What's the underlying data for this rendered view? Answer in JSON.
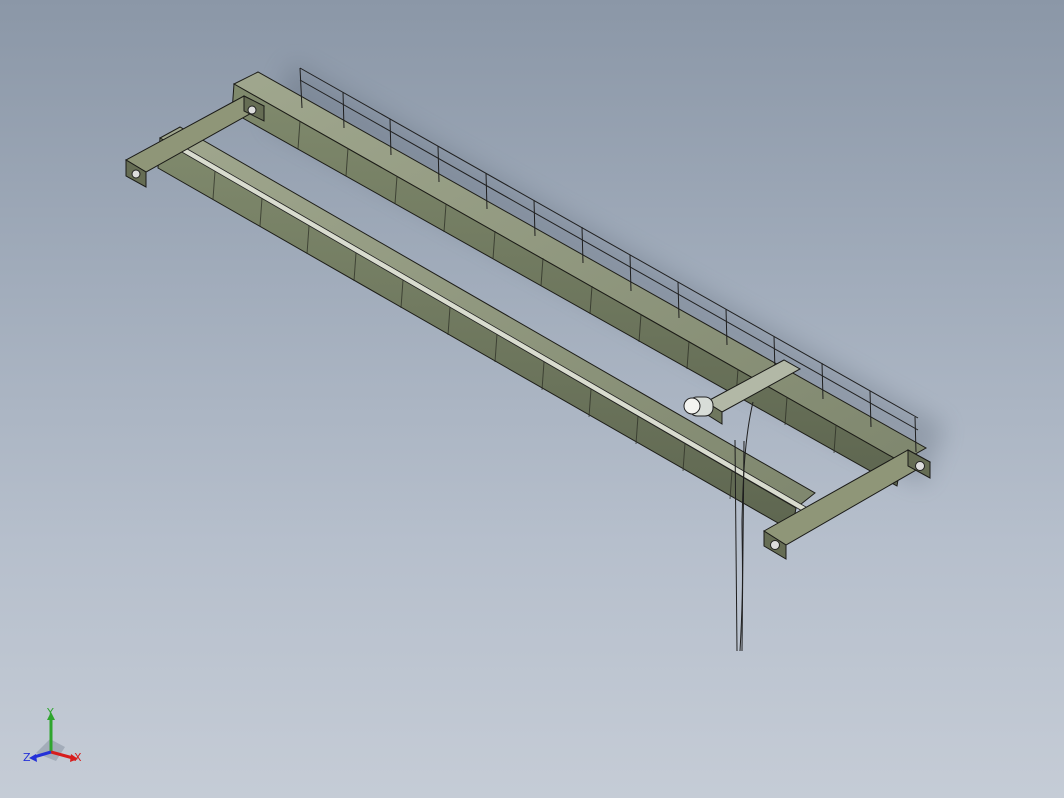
{
  "triad": {
    "x_label": "X",
    "y_label": "Y",
    "z_label": "Z"
  }
}
